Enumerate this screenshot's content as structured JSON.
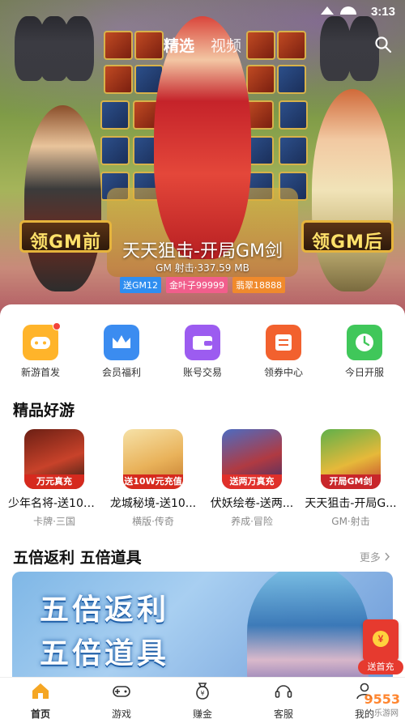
{
  "status": {
    "time": "3:13"
  },
  "top_tabs": [
    {
      "label": "精选",
      "active": true
    },
    {
      "label": "视频",
      "active": false
    }
  ],
  "hero": {
    "sign_left": "领GM前",
    "sign_right": "领GM后",
    "title": "天天狙击-开局GM剑",
    "meta": "GM 射击·337.59 MB",
    "tags": [
      "送GM12",
      "金叶子99999",
      "翡翠18888"
    ]
  },
  "quick_links": [
    {
      "label": "新游首发",
      "color": "#ffb42a",
      "icon": "gamepad-icon",
      "badge": true
    },
    {
      "label": "会员福利",
      "color": "#3b8cf0",
      "icon": "crown-icon",
      "badge": false
    },
    {
      "label": "账号交易",
      "color": "#9c5cf0",
      "icon": "wallet-icon",
      "badge": false
    },
    {
      "label": "领券中心",
      "color": "#f2612e",
      "icon": "coupon-icon",
      "badge": false
    },
    {
      "label": "今日开服",
      "color": "#40c75a",
      "icon": "clock-icon",
      "badge": false
    }
  ],
  "featured": {
    "title": "精品好游",
    "games": [
      {
        "name": "少年名将-送100...",
        "sub": "卡牌·三国",
        "caption": "万元真充"
      },
      {
        "name": "龙城秘境-送10...",
        "sub": "横版·传奇",
        "caption": "送10W元充值"
      },
      {
        "name": "伏妖绘卷-送两...",
        "sub": "养成·冒险",
        "caption": "送两万真充"
      },
      {
        "name": "天天狙击-开局G...",
        "sub": "GM·射击",
        "caption": "开局GM剑"
      }
    ]
  },
  "promo_section": {
    "title": "五倍返利 五倍道具",
    "more": "更多",
    "banner_line1": "五倍返利",
    "banner_line2": "五倍道具"
  },
  "red_packet": {
    "label": "送首充"
  },
  "bottom_nav": [
    {
      "label": "首页",
      "icon": "home-icon",
      "active": true
    },
    {
      "label": "游戏",
      "icon": "gamepad-icon",
      "active": false
    },
    {
      "label": "赚金",
      "icon": "money-bag-icon",
      "active": false
    },
    {
      "label": "客服",
      "icon": "headset-icon",
      "active": false
    },
    {
      "label": "我的",
      "icon": "user-icon",
      "active": false
    }
  ],
  "watermark": {
    "brand": "9553",
    "sub": "乐游网"
  }
}
